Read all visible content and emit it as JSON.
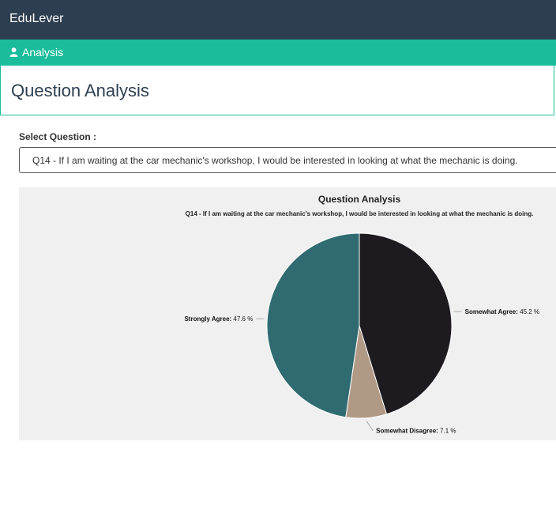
{
  "app": {
    "brand": "EduLever"
  },
  "tab": {
    "label": "Analysis",
    "icon": "user-icon"
  },
  "page": {
    "title": "Question Analysis"
  },
  "select": {
    "label": "Select Question :",
    "value": "Q14 - If I am waiting at the car mechanic's workshop, I would be interested in looking at what the mechanic is doing."
  },
  "chart_data": {
    "type": "pie",
    "title": "Question Analysis",
    "subtitle": "Q14 - If I am waiting at the car mechanic's workshop, I would be interested in looking at what the mechanic is doing.",
    "slices": [
      {
        "label": "Somewhat Agree",
        "value": 45.2,
        "display": "45.2 %",
        "color": "#1e1b20"
      },
      {
        "label": "Somewhat Disagree",
        "value": 7.1,
        "display": "7.1 %",
        "color": "#b09a86"
      },
      {
        "label": "Strongly Agree",
        "value": 47.6,
        "display": "47.6 %",
        "color": "#2f6b70"
      }
    ]
  }
}
